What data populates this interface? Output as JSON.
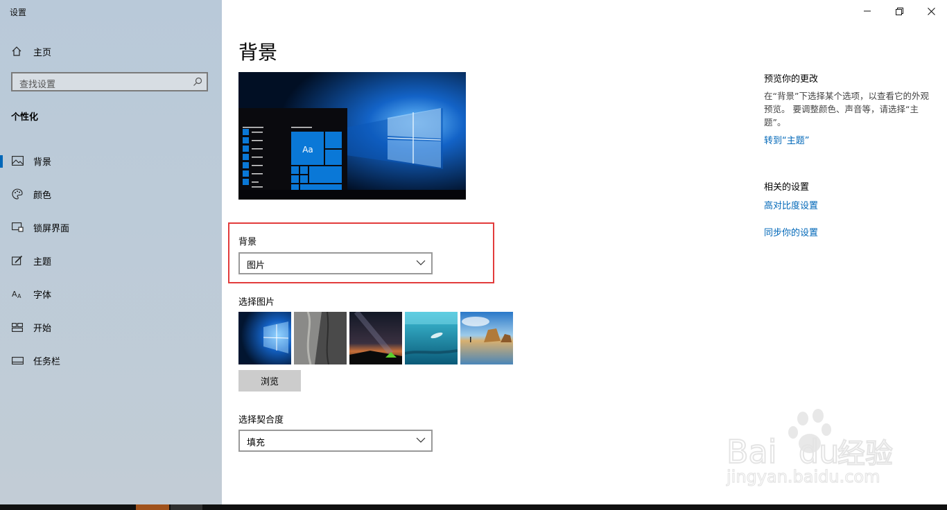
{
  "window": {
    "title": "设置"
  },
  "sidebar": {
    "home_label": "主页",
    "search_placeholder": "查找设置",
    "section_title": "个性化",
    "items": [
      {
        "label": "背景",
        "icon": "picture-icon",
        "active": true
      },
      {
        "label": "颜色",
        "icon": "palette-icon",
        "active": false
      },
      {
        "label": "锁屏界面",
        "icon": "lock-screen-icon",
        "active": false
      },
      {
        "label": "主题",
        "icon": "theme-brush-icon",
        "active": false
      },
      {
        "label": "字体",
        "icon": "font-icon",
        "active": false
      },
      {
        "label": "开始",
        "icon": "start-tiles-icon",
        "active": false
      },
      {
        "label": "任务栏",
        "icon": "taskbar-icon",
        "active": false
      }
    ]
  },
  "main": {
    "page_title": "背景",
    "preview_tile_label": "Aa",
    "background_label": "背景",
    "background_value": "图片",
    "choose_picture_label": "选择图片",
    "browse_label": "浏览",
    "fit_label": "选择契合度",
    "fit_value": "填充"
  },
  "right_panel": {
    "preview_title": "预览你的更改",
    "preview_desc": "在“背景”下选择某个选项，以查看它的外观预览。 要调整颜色、声音等，请选择“主题”。",
    "go_to_themes": "转到“主题”",
    "related_title": "相关的设置",
    "high_contrast": "高对比度设置",
    "sync_settings": "同步你的设置"
  },
  "watermark": {
    "brand": "Bai",
    "brand2": "du",
    "brand_cn": "经验",
    "url": "jingyan.baidu.com"
  },
  "colors": {
    "accent": "#0067b8",
    "highlight_box": "#e23b3b",
    "tile_blue": "#0a78d7"
  }
}
